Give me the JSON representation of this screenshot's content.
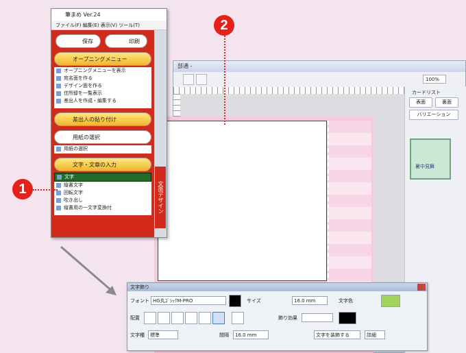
{
  "main_window": {
    "title": "部通 -",
    "zoom": "100%",
    "right_panel": {
      "header": "カードリスト",
      "buttons": [
        "表面",
        "裏面"
      ],
      "variant_button": "バリエーション",
      "thumb_label": "暑中見舞"
    }
  },
  "menu_window": {
    "title": "筆まめ Ver.24",
    "menubar": "ファイル(F)  編集(E)  表示(V)  ツール(T)",
    "buttons": {
      "save": "保存",
      "print": "印刷"
    },
    "opening_menu": "オープニングメニュー",
    "items": [
      "オープニングメニューを表示",
      "宛名面を作る",
      "デザイン面を作る",
      "住所録を一覧表示",
      "差出人を作成・編集する"
    ],
    "sender_paste": "差出人の貼り付け",
    "layout_select": "用紙の選択",
    "layout_sub": "用紙の選択",
    "text_section": "文字・文章の入力",
    "text_items": [
      "文字",
      "縦書文字",
      "回転文字",
      "吹き出し",
      "縦書用の一文字変換付"
    ],
    "selected_index": 0,
    "side_tab": "文面デザイン"
  },
  "text_window": {
    "title": "文字飾り",
    "font_label": "フォント",
    "font_value": "HG丸ｺﾞｼｯｸM-PRO",
    "size_label": "サイズ",
    "size_value": "16.0 mm",
    "color_label": "文字色",
    "align_label": "配置",
    "deco_label": "飾り効果",
    "pattern_label": "文字種",
    "pattern_value": "標準",
    "spacing_label": "間隔",
    "spacing_value": "16.0 mm",
    "effect_value": "文字を装飾する",
    "detail": "詳細"
  },
  "callouts": {
    "one": "1",
    "two": "2"
  }
}
